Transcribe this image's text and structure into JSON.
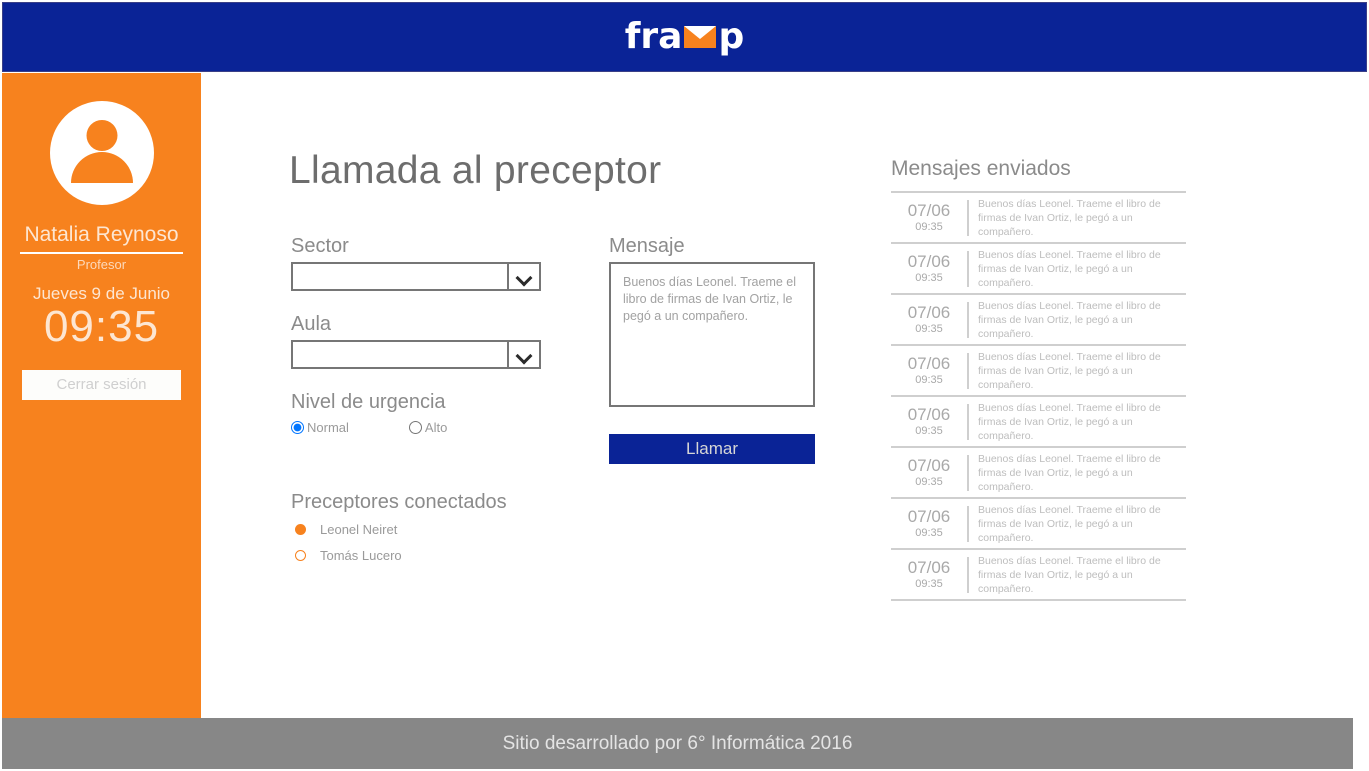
{
  "header": {
    "logo_prefix": "fra",
    "logo_icon": "envelope-icon",
    "logo_suffix": "p",
    "brand_color": "#0a2396",
    "accent_color": "#f7821e"
  },
  "sidebar": {
    "avatar_icon": "user-avatar-icon",
    "user_name": "Natalia Reynoso",
    "user_role": "Profesor",
    "date": "Jueves 9 de Junio",
    "time": "09:35",
    "logout_label": "Cerrar sesión"
  },
  "main": {
    "title": "Llamada al preceptor",
    "sector": {
      "label": "Sector",
      "value": "",
      "icon": "chevron-down-icon"
    },
    "aula": {
      "label": "Aula",
      "value": "",
      "icon": "chevron-down-icon"
    },
    "urgency": {
      "label": "Nivel de urgencia",
      "options": [
        {
          "label": "Normal",
          "selected": true
        },
        {
          "label": "Alto",
          "selected": false
        }
      ]
    },
    "preceptors": {
      "label": "Preceptores conectados",
      "items": [
        {
          "name": "Leonel Neiret",
          "status": "online"
        },
        {
          "name": "Tomás Lucero",
          "status": "offline"
        }
      ]
    },
    "message": {
      "label": "Mensaje",
      "value": "Buenos días Leonel. Traeme el libro de firmas de Ivan Ortiz, le pegó a un compañero.",
      "placeholder": ""
    },
    "call_button_label": "Llamar"
  },
  "sent_messages": {
    "title": "Mensajes enviados",
    "items": [
      {
        "date": "07/06",
        "time": "09:35",
        "text": "Buenos días Leonel. Traeme el libro de firmas de Ivan Ortiz, le pegó a un compañero."
      },
      {
        "date": "07/06",
        "time": "09:35",
        "text": "Buenos días Leonel. Traeme el libro de firmas de Ivan Ortiz, le pegó a un compañero."
      },
      {
        "date": "07/06",
        "time": "09:35",
        "text": "Buenos días Leonel. Traeme el libro de firmas de Ivan Ortiz, le pegó a un compañero."
      },
      {
        "date": "07/06",
        "time": "09:35",
        "text": "Buenos días Leonel. Traeme el libro de firmas de Ivan Ortiz, le pegó a un compañero."
      },
      {
        "date": "07/06",
        "time": "09:35",
        "text": "Buenos días Leonel. Traeme el libro de firmas de Ivan Ortiz, le pegó a un compañero."
      },
      {
        "date": "07/06",
        "time": "09:35",
        "text": "Buenos días Leonel. Traeme el libro de firmas de Ivan Ortiz, le pegó a un compañero."
      },
      {
        "date": "07/06",
        "time": "09:35",
        "text": "Buenos días Leonel. Traeme el libro de firmas de Ivan Ortiz, le pegó a un compañero."
      },
      {
        "date": "07/06",
        "time": "09:35",
        "text": "Buenos días Leonel. Traeme el libro de firmas de Ivan Ortiz, le pegó a un compañero."
      }
    ]
  },
  "footer": {
    "text": "Sitio desarrollado por 6° Informática 2016"
  }
}
